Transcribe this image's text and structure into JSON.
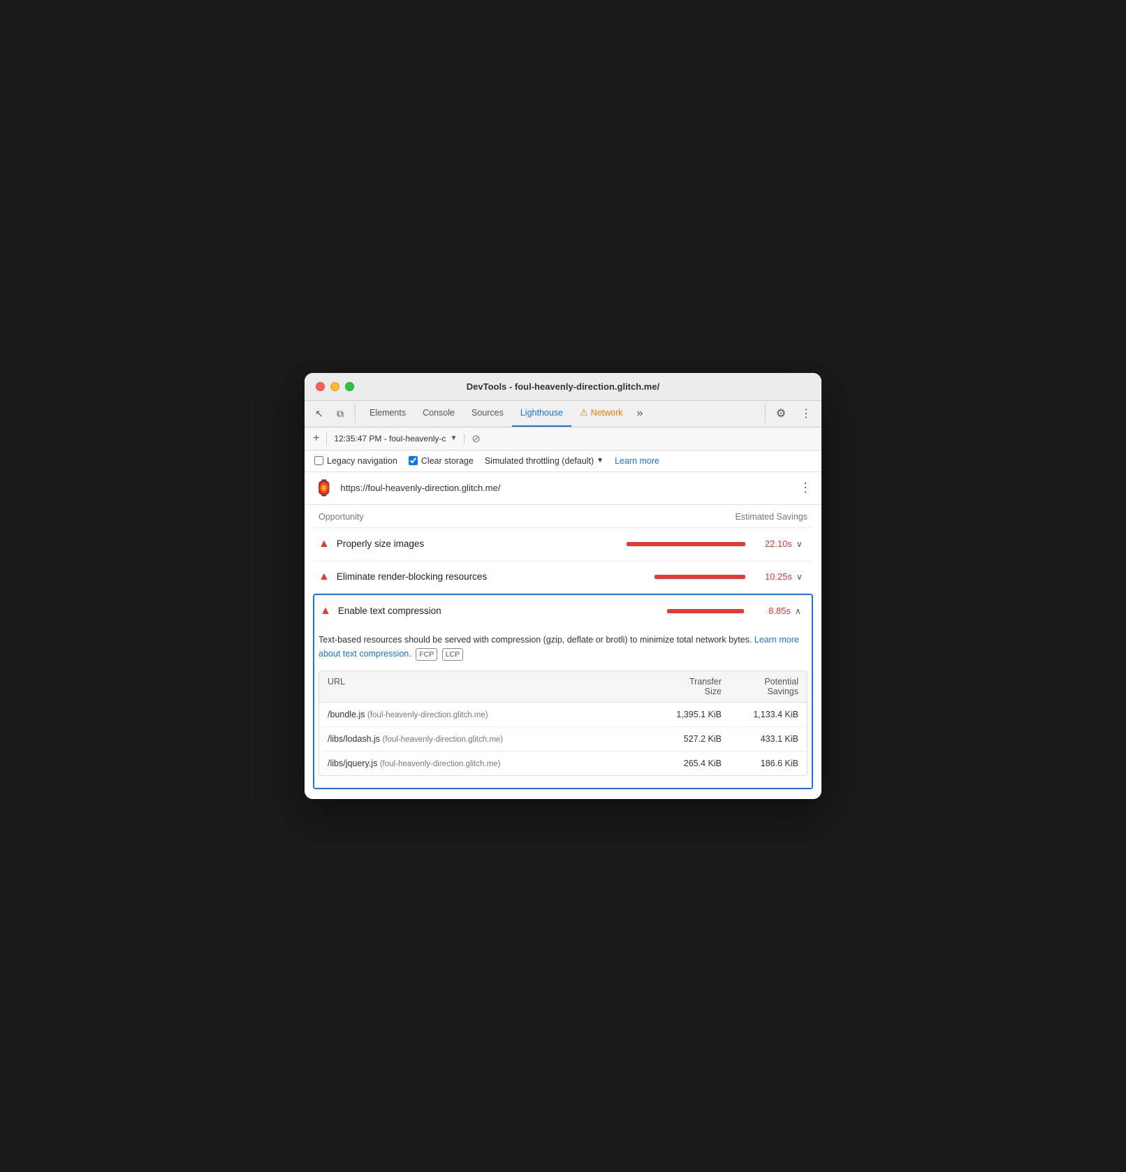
{
  "window": {
    "title": "DevTools - foul-heavenly-direction.glitch.me/"
  },
  "tabs": [
    {
      "id": "elements",
      "label": "Elements",
      "active": false
    },
    {
      "id": "console",
      "label": "Console",
      "active": false
    },
    {
      "id": "sources",
      "label": "Sources",
      "active": false
    },
    {
      "id": "lighthouse",
      "label": "Lighthouse",
      "active": true
    },
    {
      "id": "network",
      "label": "Network",
      "active": false,
      "hasWarning": true
    }
  ],
  "toolbar": {
    "session": "12:35:47 PM - foul-heavenly-c",
    "more_label": "»"
  },
  "options": {
    "legacy_nav_label": "Legacy navigation",
    "legacy_nav_checked": false,
    "clear_storage_label": "Clear storage",
    "clear_storage_checked": true,
    "throttling_label": "Simulated throttling (default)",
    "learn_more_label": "Learn more"
  },
  "url_bar": {
    "url": "https://foul-heavenly-direction.glitch.me/",
    "icon": "🏮"
  },
  "opportunities": {
    "header_left": "Opportunity",
    "header_right": "Estimated Savings",
    "items": [
      {
        "id": "properly-size-images",
        "title": "Properly size images",
        "time": "22.10s",
        "bar_width": "long",
        "expanded": false,
        "chevron": "chevron-down"
      },
      {
        "id": "eliminate-render-blocking",
        "title": "Eliminate render-blocking resources",
        "time": "10.25s",
        "bar_width": "medium",
        "expanded": false,
        "chevron": "chevron-down"
      },
      {
        "id": "enable-text-compression",
        "title": "Enable text compression",
        "time": "8.85s",
        "bar_width": "short",
        "expanded": true,
        "chevron": "chevron-up",
        "description_part1": "Text-based resources should be served with compression (gzip, deflate or brotli) to minimize total network bytes.",
        "description_link_text": "Learn more about text compression",
        "description_part2": "",
        "badges": [
          "FCP",
          "LCP"
        ],
        "table": {
          "columns": [
            "URL",
            "Transfer\nSize",
            "Potential\nSavings"
          ],
          "rows": [
            {
              "url_path": "/bundle.js",
              "url_host": "foul-heavenly-direction.glitch.me",
              "transfer_size": "1,395.1 KiB",
              "savings": "1,133.4 KiB"
            },
            {
              "url_path": "/libs/lodash.js",
              "url_host": "foul-heavenly-direction.glitch.me",
              "transfer_size": "527.2 KiB",
              "savings": "433.1 KiB"
            },
            {
              "url_path": "/libs/jquery.js",
              "url_host": "foul-heavenly-direction.glitch.me",
              "transfer_size": "265.4 KiB",
              "savings": "186.6 KiB"
            }
          ]
        }
      }
    ]
  },
  "icons": {
    "cursor": "↖",
    "layers": "⧉",
    "settings": "⚙",
    "more_vert": "⋮",
    "block": "⊘",
    "warning": "⚠",
    "triangle_warning": "▲",
    "chevron_down": "∨",
    "chevron_up": "∧"
  }
}
